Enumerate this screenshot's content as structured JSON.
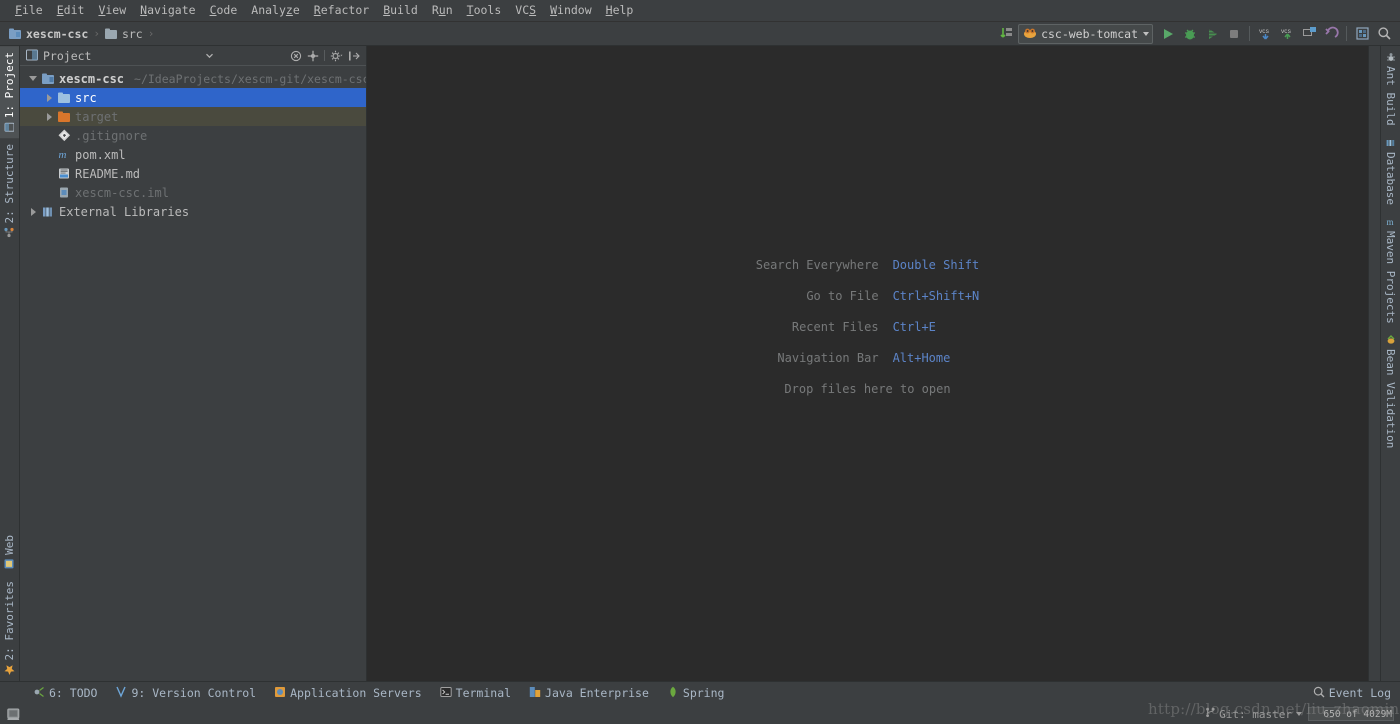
{
  "app": {
    "theme_bg_panel": "#3c3f41",
    "theme_bg_editor": "#2b2b2b",
    "accent_selection": "#2f65ca",
    "accent_link": "#5c84c8"
  },
  "menubar": {
    "items": [
      {
        "label": "File",
        "mnemonic": "F"
      },
      {
        "label": "Edit",
        "mnemonic": "E"
      },
      {
        "label": "View",
        "mnemonic": "V"
      },
      {
        "label": "Navigate",
        "mnemonic": "N"
      },
      {
        "label": "Code",
        "mnemonic": "C"
      },
      {
        "label": "Analyze",
        "mnemonic": "z"
      },
      {
        "label": "Refactor",
        "mnemonic": "R"
      },
      {
        "label": "Build",
        "mnemonic": "B"
      },
      {
        "label": "Run",
        "mnemonic": "u"
      },
      {
        "label": "Tools",
        "mnemonic": "T"
      },
      {
        "label": "VCS",
        "mnemonic": "S"
      },
      {
        "label": "Window",
        "mnemonic": "W"
      },
      {
        "label": "Help",
        "mnemonic": "H"
      }
    ]
  },
  "navbar": {
    "crumbs": [
      {
        "label": "xescm-csc",
        "icon": "module-icon"
      },
      {
        "label": "src",
        "icon": "folder-icon"
      }
    ],
    "separator": "›"
  },
  "toolbar": {
    "sync_icon": "sync-icon",
    "run_config": {
      "label": "csc-web-tomcat",
      "icon": "tomcat-icon"
    },
    "buttons": [
      {
        "name": "run-button",
        "icon": "play-icon",
        "color": "#5ab65a"
      },
      {
        "name": "debug-button",
        "icon": "bug-icon",
        "color": "#62b543"
      },
      {
        "name": "run-with-coverage-button",
        "icon": "coverage-icon",
        "color": "#62b543"
      },
      {
        "name": "stop-button",
        "icon": "stop-icon",
        "color": "#8b8b8b"
      },
      {
        "name": "vcs-update-button",
        "icon": "vcs-update-icon",
        "color": "#5c9ccc"
      },
      {
        "name": "vcs-commit-button",
        "icon": "vcs-commit-icon",
        "color": "#62b543"
      },
      {
        "name": "vcs-history-button",
        "icon": "vcs-history-icon",
        "color": "#a0a0a0"
      },
      {
        "name": "undo-button",
        "icon": "undo-icon",
        "color": "#9876aa"
      },
      {
        "name": "settings-button",
        "icon": "settings-icon",
        "color": "#6897bb"
      },
      {
        "name": "search-button",
        "icon": "search-icon",
        "color": "#b0b0b0"
      }
    ]
  },
  "left_stripe": {
    "top": [
      {
        "label": "1: Project",
        "icon": "project-icon",
        "active": true
      },
      {
        "label": "2: Structure",
        "icon": "structure-icon",
        "active": false
      }
    ],
    "bottom": [
      {
        "label": "Web",
        "icon": "web-icon",
        "active": false
      },
      {
        "label": "2: Favorites",
        "icon": "star-icon",
        "active": false
      }
    ]
  },
  "right_stripe": {
    "items": [
      {
        "label": "Ant Build",
        "icon": "ant-icon"
      },
      {
        "label": "Database",
        "icon": "database-icon"
      },
      {
        "label": "Maven Projects",
        "icon": "maven-icon"
      },
      {
        "label": "Bean Validation",
        "icon": "bean-icon"
      }
    ]
  },
  "project_panel": {
    "title": "Project",
    "title_icon": "project-view-icon",
    "dropdown_icon": "chevron-down-icon",
    "header_buttons": [
      {
        "name": "collapse-all-button",
        "icon": "collapse-all-icon"
      },
      {
        "name": "scroll-from-source-button",
        "icon": "target-icon"
      },
      {
        "name": "settings-button",
        "icon": "gear-icon"
      },
      {
        "name": "hide-button",
        "icon": "hide-icon"
      }
    ],
    "tree": [
      {
        "label": "xescm-csc",
        "sublabel": "~/IdeaProjects/xescm-git/xescm-csc",
        "icon": "module-icon",
        "indent": 0,
        "expanded": true,
        "has_arrow": true,
        "state": "bold"
      },
      {
        "label": "src",
        "sublabel": "",
        "icon": "folder-source-icon",
        "indent": 1,
        "expanded": false,
        "has_arrow": true,
        "state": "selected"
      },
      {
        "label": "target",
        "sublabel": "",
        "icon": "folder-excluded-icon",
        "indent": 1,
        "expanded": false,
        "has_arrow": true,
        "state": "excluded"
      },
      {
        "label": ".gitignore",
        "sublabel": "",
        "icon": "git-icon",
        "indent": 1,
        "expanded": false,
        "has_arrow": false,
        "state": "dim"
      },
      {
        "label": "pom.xml",
        "sublabel": "",
        "icon": "maven-pom-icon",
        "indent": 1,
        "expanded": false,
        "has_arrow": false,
        "state": "normal"
      },
      {
        "label": "README.md",
        "sublabel": "",
        "icon": "markdown-icon",
        "indent": 1,
        "expanded": false,
        "has_arrow": false,
        "state": "normal"
      },
      {
        "label": "xescm-csc.iml",
        "sublabel": "",
        "icon": "iml-icon",
        "indent": 1,
        "expanded": false,
        "has_arrow": false,
        "state": "dim"
      },
      {
        "label": "External Libraries",
        "sublabel": "",
        "icon": "libraries-icon",
        "indent": 0,
        "expanded": false,
        "has_arrow": true,
        "state": "normal"
      }
    ]
  },
  "welcome": {
    "rows": [
      {
        "label": "Search Everywhere",
        "shortcut": "Double Shift"
      },
      {
        "label": "Go to File",
        "shortcut": "Ctrl+Shift+N"
      },
      {
        "label": "Recent Files",
        "shortcut": "Ctrl+E"
      },
      {
        "label": "Navigation Bar",
        "shortcut": "Alt+Home"
      }
    ],
    "drop_hint": "Drop files here to open"
  },
  "toolwindow_bar": {
    "items": [
      {
        "label": "6: TODO",
        "underline": "6",
        "icon": "todo-icon"
      },
      {
        "label": "9: Version Control",
        "underline": "9",
        "icon": "vcs-icon"
      },
      {
        "label": "Application Servers",
        "underline": "",
        "icon": "app-server-icon"
      },
      {
        "label": "Terminal",
        "underline": "",
        "icon": "terminal-icon"
      },
      {
        "label": "Java Enterprise",
        "underline": "",
        "icon": "javaee-icon"
      },
      {
        "label": "Spring",
        "underline": "",
        "icon": "spring-icon"
      }
    ],
    "event_log": {
      "label": "Event Log",
      "icon": "event-log-icon"
    }
  },
  "statusbar": {
    "message": "",
    "git_branch": {
      "label": "Git: master",
      "icon": "branch-icon"
    },
    "memory": "650 of 4029M",
    "left_icon": "show-toolwindows-icon"
  },
  "watermark": {
    "text": "http://blog.csdn.net/liu_zhaoming"
  }
}
